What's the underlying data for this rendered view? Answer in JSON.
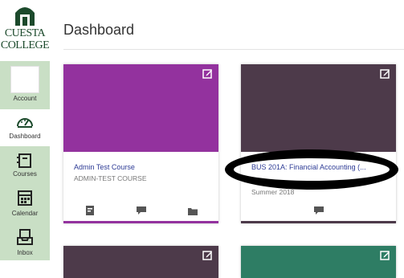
{
  "logo": {
    "line1": "CUESTA",
    "line2": "COLLEGE"
  },
  "nav": {
    "account": "Account",
    "dashboard": "Dashboard",
    "courses": "Courses",
    "calendar": "Calendar",
    "inbox": "Inbox"
  },
  "page": {
    "title": "Dashboard"
  },
  "cards": [
    {
      "title": "Admin Test Course",
      "code": "ADMIN-TEST COURSE",
      "color": "#93329e"
    },
    {
      "title": "BUS 201A: Financial Accounting (...",
      "term": "Summer 2018",
      "color": "#4d3a4a"
    },
    {
      "color": "#4d3a4a"
    },
    {
      "color": "#2e7d64"
    }
  ],
  "colors": {
    "nav_bg": "#c9dfc5",
    "link": "#2d3b95",
    "logo_green": "#1c4a2c"
  }
}
